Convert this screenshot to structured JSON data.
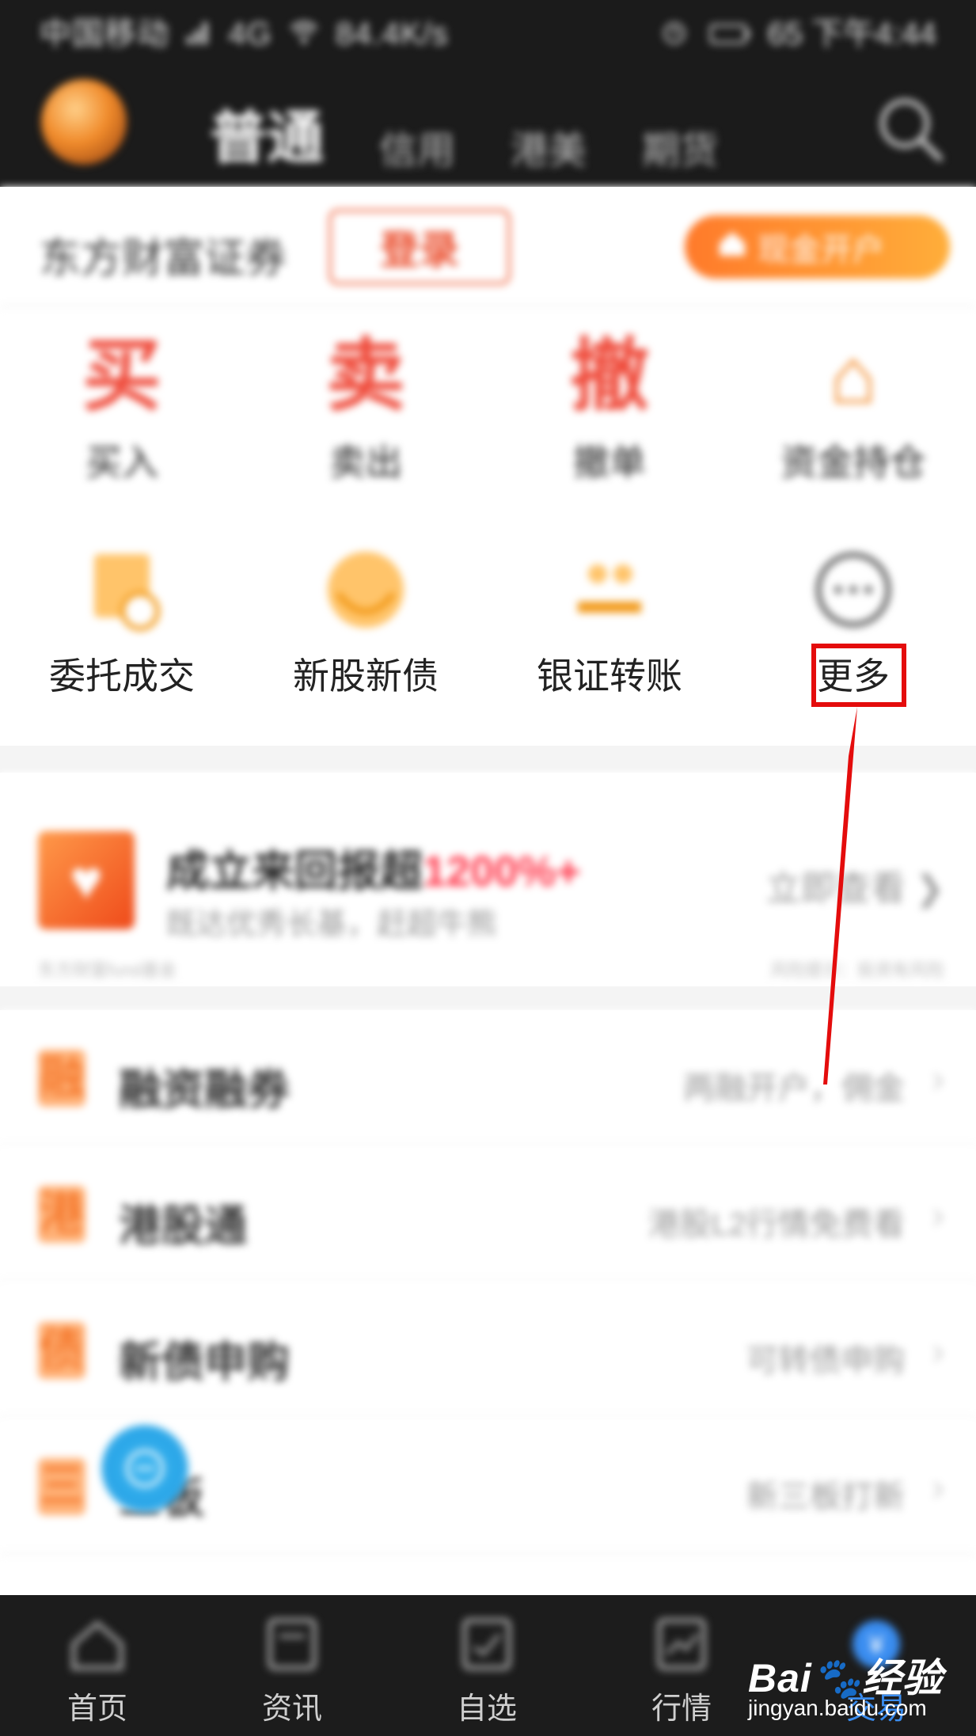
{
  "status_bar": {
    "carrier": "中国移动",
    "network": "4G",
    "speed": "84.4K/s",
    "battery": "65",
    "time": "下午4:44"
  },
  "header": {
    "tabs": [
      {
        "label": "普通",
        "active": true
      },
      {
        "label": "信用",
        "active": false
      },
      {
        "label": "港美",
        "active": false
      },
      {
        "label": "期货",
        "active": false
      }
    ]
  },
  "account": {
    "broker_name": "东方财富证券",
    "login_label": "登录",
    "open_account_label": "现金开户"
  },
  "quick_grid": {
    "row1": [
      {
        "glyph": "买",
        "label": "买入"
      },
      {
        "glyph": "卖",
        "label": "卖出"
      },
      {
        "glyph": "撤",
        "label": "撤单"
      },
      {
        "glyph": "⌂",
        "label": "资金持仓"
      }
    ],
    "row2": [
      {
        "label": "委托成交"
      },
      {
        "label": "新股新债"
      },
      {
        "label": "银证转账"
      },
      {
        "label": "更多"
      }
    ]
  },
  "promo": {
    "title": "成立来回报超",
    "highlight": "1200%+",
    "subtitle": "既达优秀长基，赶超牛熊",
    "cta": "立即查看 ❯",
    "disclaimer": "东方财富fund基金",
    "disclaimer_right": "风险提示：投资有风险"
  },
  "feature_list": [
    {
      "icon": "融",
      "title": "融资融券",
      "desc": "两融开户，佣金"
    },
    {
      "icon": "港",
      "title": "港股通",
      "desc": "港股L2行情免费看"
    },
    {
      "icon": "债",
      "title": "新债申购",
      "desc": "可转债申购"
    },
    {
      "icon": "三",
      "title": "三板",
      "desc": "新三板打新"
    }
  ],
  "bottom_tabs": [
    {
      "label": "首页",
      "icon": "home-icon",
      "active": false
    },
    {
      "label": "资讯",
      "icon": "news-icon",
      "active": false
    },
    {
      "label": "自选",
      "icon": "watchlist-icon",
      "active": false
    },
    {
      "label": "行情",
      "icon": "chart-icon",
      "active": false
    },
    {
      "label": "交易",
      "icon": "trade-icon",
      "active": true
    }
  ],
  "watermark": {
    "logo": "Bai🐾经验",
    "site": "jingyan.baidu.com"
  },
  "colors": {
    "accent_red": "#ef4a3a",
    "accent_orange": "#f28a2a",
    "highlight_box": "#e40c0c",
    "tab_active": "#3a8df0"
  }
}
